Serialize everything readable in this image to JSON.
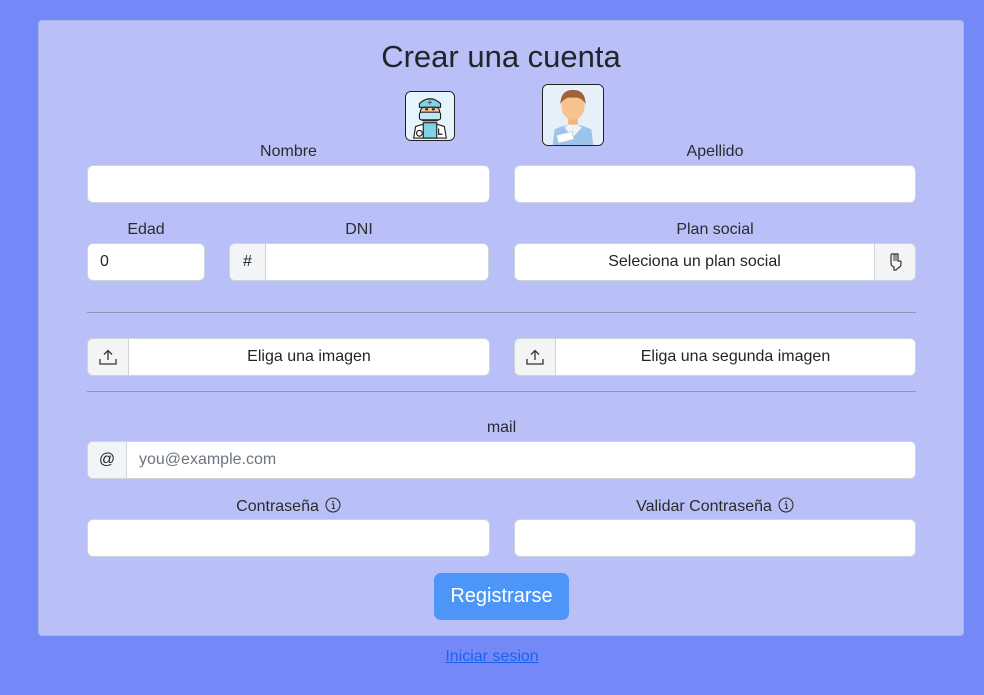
{
  "form": {
    "title": "Crear una cuenta",
    "avatars": [
      {
        "icon": "doctor-avatar-icon"
      },
      {
        "icon": "patient-avatar-icon"
      }
    ],
    "nombre": {
      "label": "Nombre",
      "value": ""
    },
    "apellido": {
      "label": "Apellido",
      "value": ""
    },
    "edad": {
      "label": "Edad",
      "value": "0"
    },
    "dni": {
      "label": "DNI",
      "prefix": "#",
      "value": ""
    },
    "plan_social": {
      "label": "Plan social",
      "selected": "Seleciona un plan social",
      "icon": "hand-pointing-down-icon"
    },
    "imagen1": {
      "label": "Eliga una imagen",
      "icon": "upload-icon"
    },
    "imagen2": {
      "label": "Eliga una segunda imagen",
      "icon": "upload-icon"
    },
    "mail": {
      "label": "mail",
      "prefix": "@",
      "placeholder": "you@example.com",
      "value": ""
    },
    "password": {
      "label": "Contraseña",
      "icon": "info-icon",
      "value": ""
    },
    "password_confirm": {
      "label": "Validar Contraseña",
      "icon": "info-icon",
      "value": ""
    },
    "submit_label": "Registrarse"
  },
  "login_link": "Iniciar sesion",
  "colors": {
    "background": "#7489f7",
    "card": "#b8c0f7",
    "primary_button": "#4d96f8",
    "link": "#1a63f0"
  }
}
